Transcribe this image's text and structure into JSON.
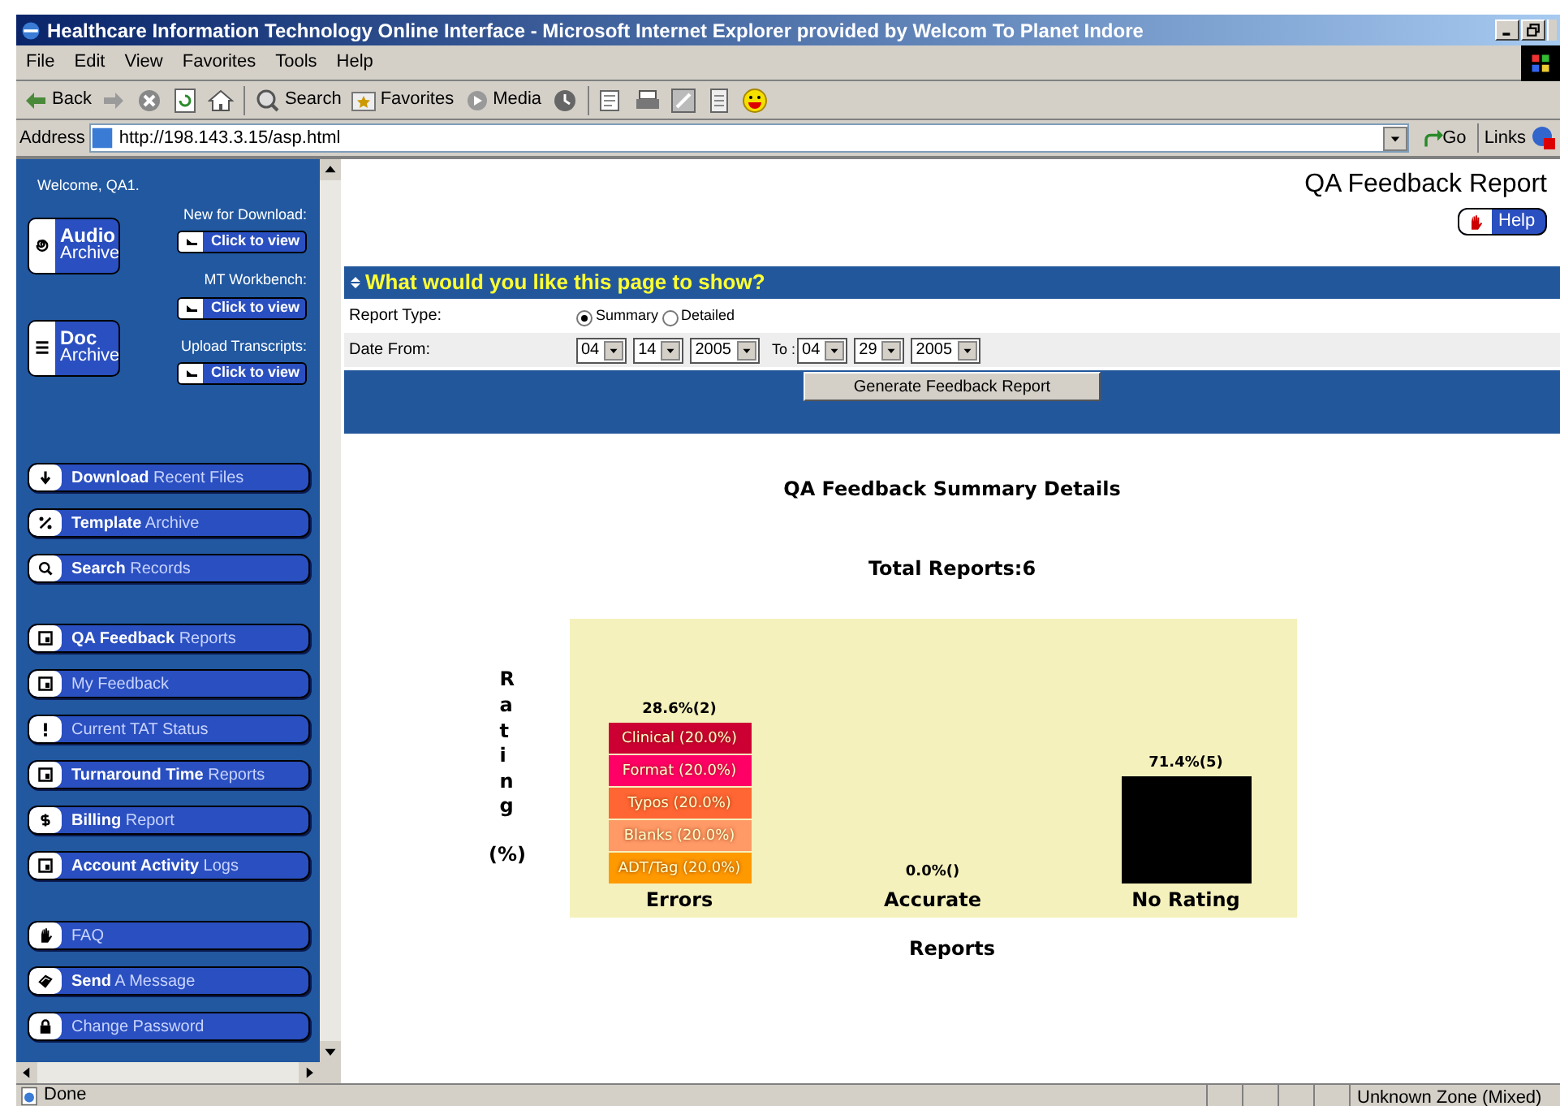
{
  "window": {
    "title": "Healthcare Information Technology Online Interface - Microsoft Internet Explorer provided by Welcom To Planet Indore"
  },
  "menu": [
    "File",
    "Edit",
    "View",
    "Favorites",
    "Tools",
    "Help"
  ],
  "toolbar": [
    {
      "kind": "back",
      "label": "Back"
    },
    {
      "kind": "forward"
    },
    {
      "kind": "stop"
    },
    {
      "kind": "refresh"
    },
    {
      "kind": "home"
    },
    {
      "kind": "search",
      "label": "Search"
    },
    {
      "kind": "favorites",
      "label": "Favorites"
    },
    {
      "kind": "media",
      "label": "Media"
    },
    {
      "kind": "history"
    },
    {
      "kind": "mail"
    },
    {
      "kind": "print"
    },
    {
      "kind": "edit"
    },
    {
      "kind": "notes"
    },
    {
      "kind": "smiley"
    }
  ],
  "address": {
    "label": "Address",
    "value": "http://198.143.3.15/asp.html",
    "go": "Go",
    "links": "Links"
  },
  "sidebar": {
    "welcome": "Welcome, QA1.",
    "archives": [
      {
        "kind": "audio",
        "title": "Audio",
        "subtitle": "Archive"
      },
      {
        "kind": "doc",
        "title": "Doc",
        "subtitle": "Archive"
      }
    ],
    "quick_links": [
      {
        "label": "New for Download:",
        "button": "Click to view"
      },
      {
        "label": "MT Workbench:",
        "button": "Click to view"
      },
      {
        "label": "Upload Transcripts:",
        "button": "Click to view"
      }
    ],
    "nav_groups": [
      [
        {
          "kind": "download",
          "label": "**Download** Recent Files"
        },
        {
          "kind": "template",
          "label": "**Template** Archive"
        },
        {
          "kind": "search",
          "label": "**Search** Records"
        }
      ],
      [
        {
          "kind": "report",
          "label": "**QA Feedback** Reports"
        },
        {
          "kind": "report",
          "label": "My Feedback"
        },
        {
          "kind": "alert",
          "label": "Current TAT Status"
        },
        {
          "kind": "report",
          "label": "**Turnaround Time** Reports"
        },
        {
          "kind": "dollar",
          "label": "**Billing** Report"
        },
        {
          "kind": "report",
          "label": "**Account Activity** Logs"
        }
      ],
      [
        {
          "kind": "hand",
          "label": "FAQ"
        },
        {
          "kind": "message",
          "label": "**Send** A Message"
        },
        {
          "kind": "lock",
          "label": "Change Password"
        }
      ]
    ]
  },
  "main": {
    "heading": "QA Feedback Report",
    "help": "Help",
    "panel_title": "What would you like this page to show?",
    "report_type": {
      "label": "Report Type:",
      "options": [
        {
          "label": "Summary",
          "selected": true
        },
        {
          "label": "Detailed",
          "selected": false
        }
      ]
    },
    "date": {
      "label": "Date From:",
      "from": [
        "04",
        "14",
        "2005"
      ],
      "to_label": "To :",
      "to": [
        "04",
        "29",
        "2005"
      ]
    },
    "generate": "Generate Feedback Report",
    "chart": {
      "title": "QA Feedback Summary Details",
      "total": "Total Reports:6",
      "ylabel": "Rating",
      "yunit": "(%)",
      "xlabel": "Reports",
      "bars": [
        {
          "kind": "stacked",
          "category": "Errors",
          "value_label": "28.6%(2)",
          "segments": [
            {
              "label": "Clinical (20.0%)",
              "color": "#cc0033"
            },
            {
              "label": "Format (20.0%)",
              "color": "#ff0066"
            },
            {
              "label": "Typos (20.0%)",
              "color": "#ff6633"
            },
            {
              "label": "Blanks (20.0%)",
              "color": "#ff9966"
            },
            {
              "label": "ADT/Tag (20.0%)",
              "color": "#ff9900"
            }
          ]
        },
        {
          "kind": "empty",
          "category": "Accurate",
          "value_label": "0.0%()"
        },
        {
          "kind": "solid",
          "category": "No Rating",
          "value_label": "71.4%(5)",
          "color": "#000000"
        }
      ]
    }
  },
  "status_bar": {
    "text": "Done",
    "zone": "Unknown Zone (Mixed)"
  }
}
